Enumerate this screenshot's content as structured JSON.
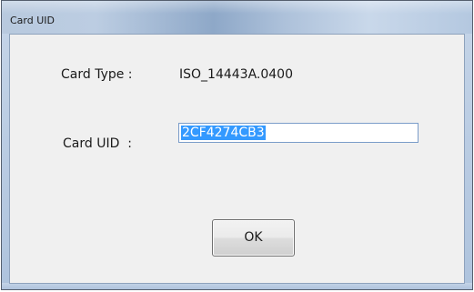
{
  "window": {
    "title": "Card UID"
  },
  "form": {
    "card_type_label": "Card Type :",
    "card_type_value": "ISO_14443A.0400",
    "card_uid_label": "Card UID  :",
    "card_uid_value": "2CF4274CB3"
  },
  "buttons": {
    "ok_label": "OK"
  },
  "colors": {
    "selection": "#3399ff",
    "client_background": "#f0f0f0",
    "frame": "#b9cde5"
  }
}
